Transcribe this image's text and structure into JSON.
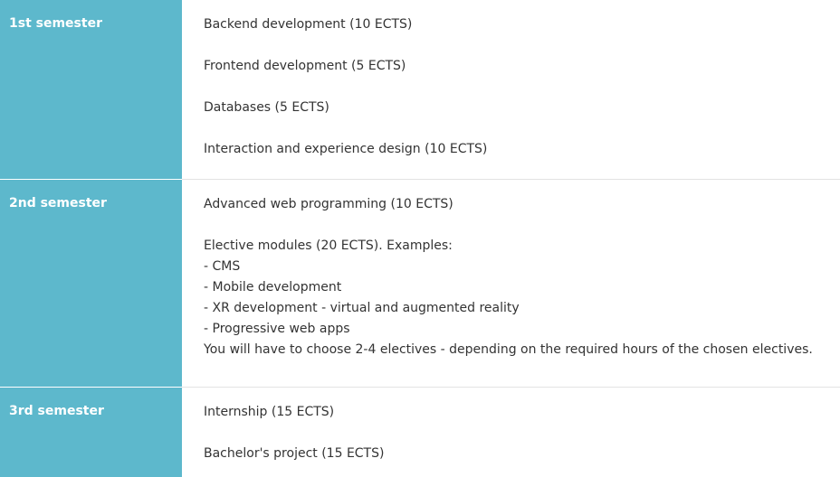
{
  "semesters": [
    {
      "label": "1st semester",
      "entries": [
        {
          "lines": [
            "Backend development (10 ECTS)"
          ]
        },
        {
          "lines": [
            "Frontend development (5 ECTS)"
          ]
        },
        {
          "lines": [
            "Databases (5 ECTS)"
          ]
        },
        {
          "lines": [
            "Interaction and experience design (10 ECTS)"
          ]
        }
      ]
    },
    {
      "label": "2nd semester",
      "entries": [
        {
          "lines": [
            "Advanced web programming (10 ECTS)"
          ]
        },
        {
          "lines": [
            "Elective modules (20 ECTS). Examples:",
            "- CMS",
            "- Mobile development",
            "- XR development - virtual and augmented reality",
            "- Progressive web apps",
            "You will have to choose 2-4 electives - depending on the required hours of the chosen electives."
          ]
        }
      ]
    },
    {
      "label": "3rd semester",
      "entries": [
        {
          "lines": [
            "Internship (15 ECTS)"
          ]
        },
        {
          "lines": [
            "Bachelor's project (15 ECTS)"
          ]
        }
      ]
    }
  ]
}
